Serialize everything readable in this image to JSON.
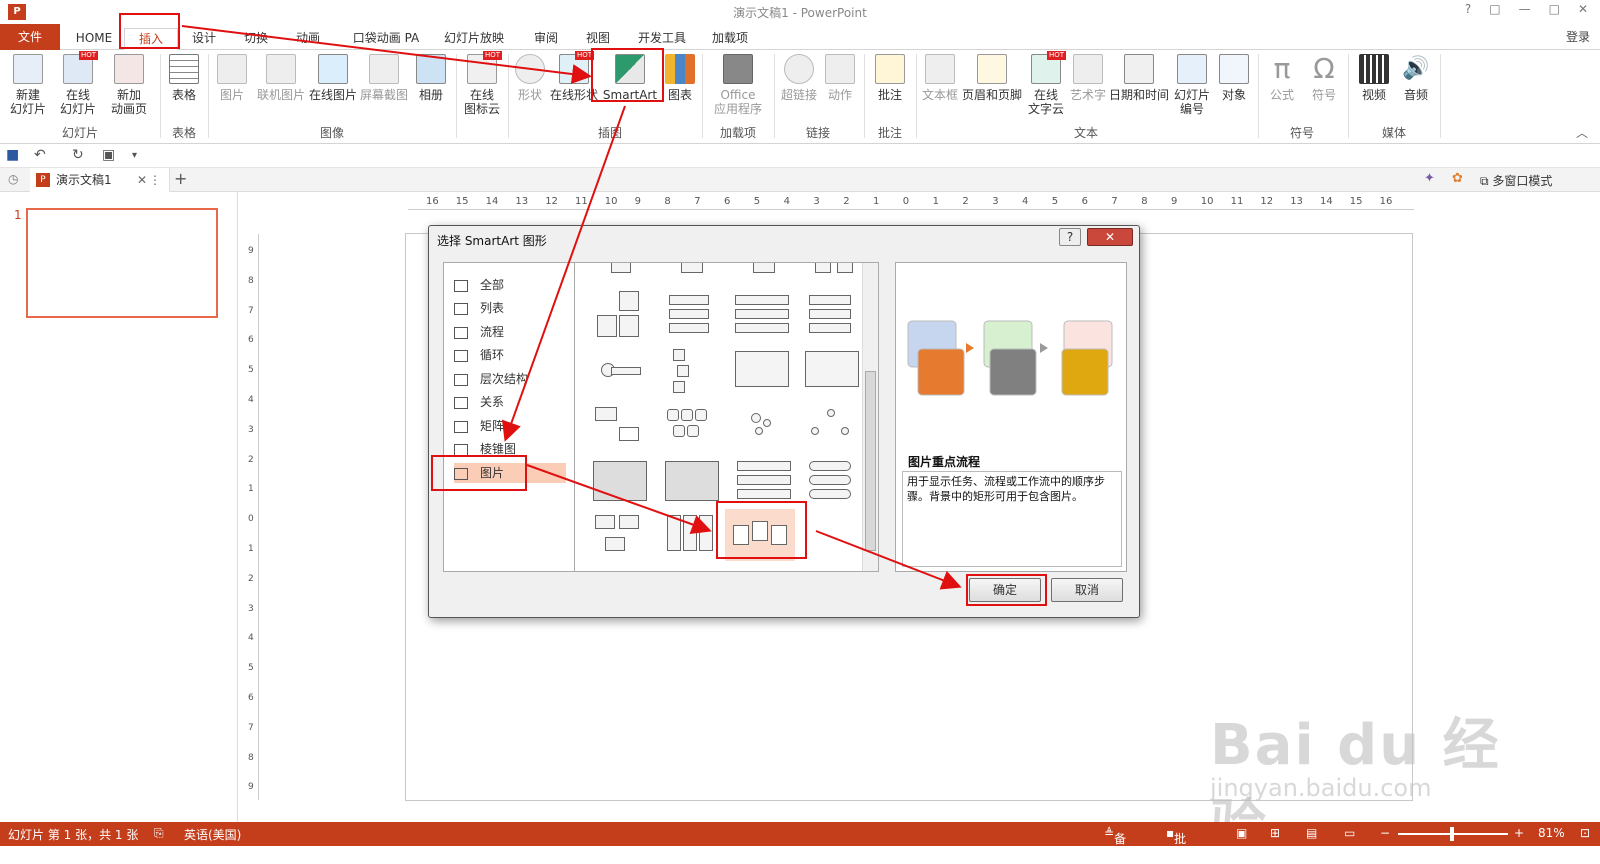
{
  "window": {
    "title": "演示文稿1 - PowerPoint",
    "app_icon": "P",
    "login": "登录",
    "controls": [
      "?",
      "□",
      "—",
      "□",
      "✕"
    ]
  },
  "tabs": [
    "文件",
    "HOME",
    "插入",
    "设计",
    "切换",
    "动画",
    "口袋动画 PA",
    "幻灯片放映",
    "审阅",
    "视图",
    "开发工具",
    "加载项"
  ],
  "ribbon": {
    "buttons": {
      "new_slide": "新建\n幻灯片",
      "online_slide": "在线\n幻灯片",
      "new_anim": "新加\n动画页",
      "table": "表格",
      "picture": "图片",
      "online_pic": "联机图片",
      "online_pic2": "在线图片",
      "screenshot": "屏幕截图",
      "album": "相册",
      "icon_cloud": "在线\n图标云",
      "shapes": "形状",
      "online_shapes": "在线形状",
      "smartart": "SmartArt",
      "chart": "图表",
      "office_apps": "Office\n应用程序",
      "hyperlink": "超链接",
      "action": "动作",
      "comment": "批注",
      "textbox": "文本框",
      "header_footer": "页眉和页脚",
      "word_cloud": "在线\n文字云",
      "wordart": "艺术字",
      "datetime": "日期和时间",
      "slide_number": "幻灯片\n编号",
      "object": "对象",
      "equation": "公式",
      "symbol": "符号",
      "video": "视频",
      "audio": "音频"
    },
    "hot_label": "HOT",
    "groups": [
      "幻灯片",
      "表格",
      "图像",
      "插图",
      "加载项",
      "链接",
      "批注",
      "文本",
      "符号",
      "媒体"
    ]
  },
  "doc_tab": {
    "name": "演示文稿1",
    "multi_window": "多窗口模式"
  },
  "slides_panel": {
    "slide_number": "1"
  },
  "ruler": {
    "h_ticks": [
      "16",
      "15",
      "14",
      "13",
      "12",
      "11",
      "10",
      "9",
      "8",
      "7",
      "6",
      "5",
      "4",
      "3",
      "2",
      "1",
      "0",
      "1",
      "2",
      "3",
      "4",
      "5",
      "6",
      "7",
      "8",
      "9",
      "10",
      "11",
      "12",
      "13",
      "14",
      "15",
      "16"
    ],
    "v_ticks": [
      "9",
      "8",
      "7",
      "6",
      "5",
      "4",
      "3",
      "2",
      "1",
      "0",
      "1",
      "2",
      "3",
      "4",
      "5",
      "6",
      "7",
      "8",
      "9"
    ]
  },
  "dialog": {
    "title": "选择 SmartArt 图形",
    "help": "?",
    "close": "✕",
    "categories": [
      "全部",
      "列表",
      "流程",
      "循环",
      "层次结构",
      "关系",
      "矩阵",
      "棱锥图",
      "图片"
    ],
    "selected_category": "图片",
    "preview_title": "图片重点流程",
    "preview_desc": "用于显示任务、流程或工作流中的顺序步骤。背景中的矩形可用于包含图片。",
    "ok": "确定",
    "cancel": "取消",
    "colors": {
      "blue": "#c5d6ee",
      "orange": "#e67a2e",
      "green": "#d6f0d0",
      "gray": "#808080",
      "pink": "#fbe4e0",
      "gold": "#e0a810"
    }
  },
  "status": {
    "left": "幻灯片 第 1 张，共 1 张",
    "lang": "英语(美国)",
    "notes": "备注",
    "comments": "批注",
    "zoom": "81%"
  },
  "watermark": {
    "big": "Bai du 经验",
    "small": "jingyan.baidu.com"
  },
  "colors": {
    "accent": "#c43e1c",
    "highlight": "#e01010"
  }
}
